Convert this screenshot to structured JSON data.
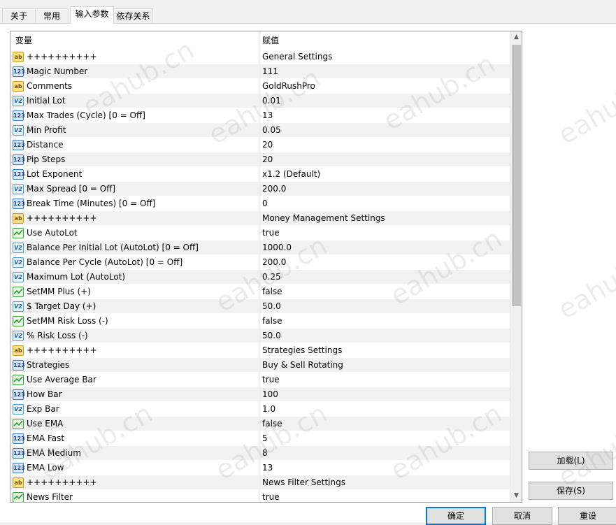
{
  "tabs": [
    {
      "label": "关于",
      "active": false
    },
    {
      "label": "常用",
      "active": false
    },
    {
      "label": "输入参数",
      "active": true
    },
    {
      "label": "依存关系",
      "active": false
    }
  ],
  "grid": {
    "col_variable": "变量",
    "col_value": "赋值",
    "rows": [
      {
        "type": "string",
        "icon": "ab",
        "name": "++++++++++",
        "value": "General Settings"
      },
      {
        "type": "int",
        "icon": "123",
        "name": "Magic Number",
        "value": "111"
      },
      {
        "type": "string",
        "icon": "ab",
        "name": "Comments",
        "value": "GoldRushPro"
      },
      {
        "type": "double",
        "icon": "V2",
        "name": "Initial Lot",
        "value": "0.01"
      },
      {
        "type": "int",
        "icon": "123",
        "name": "Max Trades (Cycle) [0 = Off]",
        "value": "13"
      },
      {
        "type": "double",
        "icon": "V2",
        "name": "Min Profit",
        "value": "0.05"
      },
      {
        "type": "int",
        "icon": "123",
        "name": "Distance",
        "value": "20"
      },
      {
        "type": "int",
        "icon": "123",
        "name": "Pip Steps",
        "value": "20"
      },
      {
        "type": "int",
        "icon": "123",
        "name": "Lot Exponent",
        "value": "x1.2 (Default)"
      },
      {
        "type": "double",
        "icon": "V2",
        "name": "Max Spread [0 = Off]",
        "value": "200.0"
      },
      {
        "type": "int",
        "icon": "123",
        "name": "Break Time (Minutes) [0 = Off]",
        "value": "0"
      },
      {
        "type": "string",
        "icon": "ab",
        "name": "++++++++++",
        "value": "Money Management Settings"
      },
      {
        "type": "bool",
        "icon": "bool",
        "name": "Use AutoLot",
        "value": "true"
      },
      {
        "type": "double",
        "icon": "V2",
        "name": "Balance Per Initial Lot (AutoLot) [0 = Off]",
        "value": "1000.0"
      },
      {
        "type": "double",
        "icon": "V2",
        "name": "Balance Per Cycle (AutoLot) [0 = Off]",
        "value": "200.0"
      },
      {
        "type": "double",
        "icon": "V2",
        "name": "Maximum Lot (AutoLot)",
        "value": "0.25"
      },
      {
        "type": "bool",
        "icon": "bool",
        "name": "SetMM Plus (+)",
        "value": "false"
      },
      {
        "type": "double",
        "icon": "V2",
        "name": "$ Target Day (+)",
        "value": "50.0"
      },
      {
        "type": "bool",
        "icon": "bool",
        "name": "SetMM Risk Loss (-)",
        "value": "false"
      },
      {
        "type": "double",
        "icon": "V2",
        "name": "% Risk Loss (-)",
        "value": "50.0"
      },
      {
        "type": "string",
        "icon": "ab",
        "name": "++++++++++",
        "value": "Strategies Settings"
      },
      {
        "type": "int",
        "icon": "123",
        "name": "Strategies",
        "value": "Buy & Sell Rotating"
      },
      {
        "type": "bool",
        "icon": "bool",
        "name": "Use Average Bar",
        "value": "true"
      },
      {
        "type": "int",
        "icon": "123",
        "name": "How Bar",
        "value": "100"
      },
      {
        "type": "double",
        "icon": "V2",
        "name": "Exp Bar",
        "value": "1.0"
      },
      {
        "type": "bool",
        "icon": "bool",
        "name": "Use EMA",
        "value": "false"
      },
      {
        "type": "int",
        "icon": "123",
        "name": "EMA Fast",
        "value": "5"
      },
      {
        "type": "int",
        "icon": "123",
        "name": "EMA Medium",
        "value": "8"
      },
      {
        "type": "int",
        "icon": "123",
        "name": "EMA Low",
        "value": "13"
      },
      {
        "type": "string",
        "icon": "ab",
        "name": "++++++++++",
        "value": "News Filter Settings"
      },
      {
        "type": "bool",
        "icon": "bool",
        "name": "News Filter",
        "value": "true"
      }
    ]
  },
  "side_buttons": {
    "load": "加载(L)",
    "save": "保存(S)"
  },
  "footer_buttons": {
    "ok": "确定",
    "cancel": "取消",
    "reset": "重设"
  },
  "watermark": "eahub.cn"
}
